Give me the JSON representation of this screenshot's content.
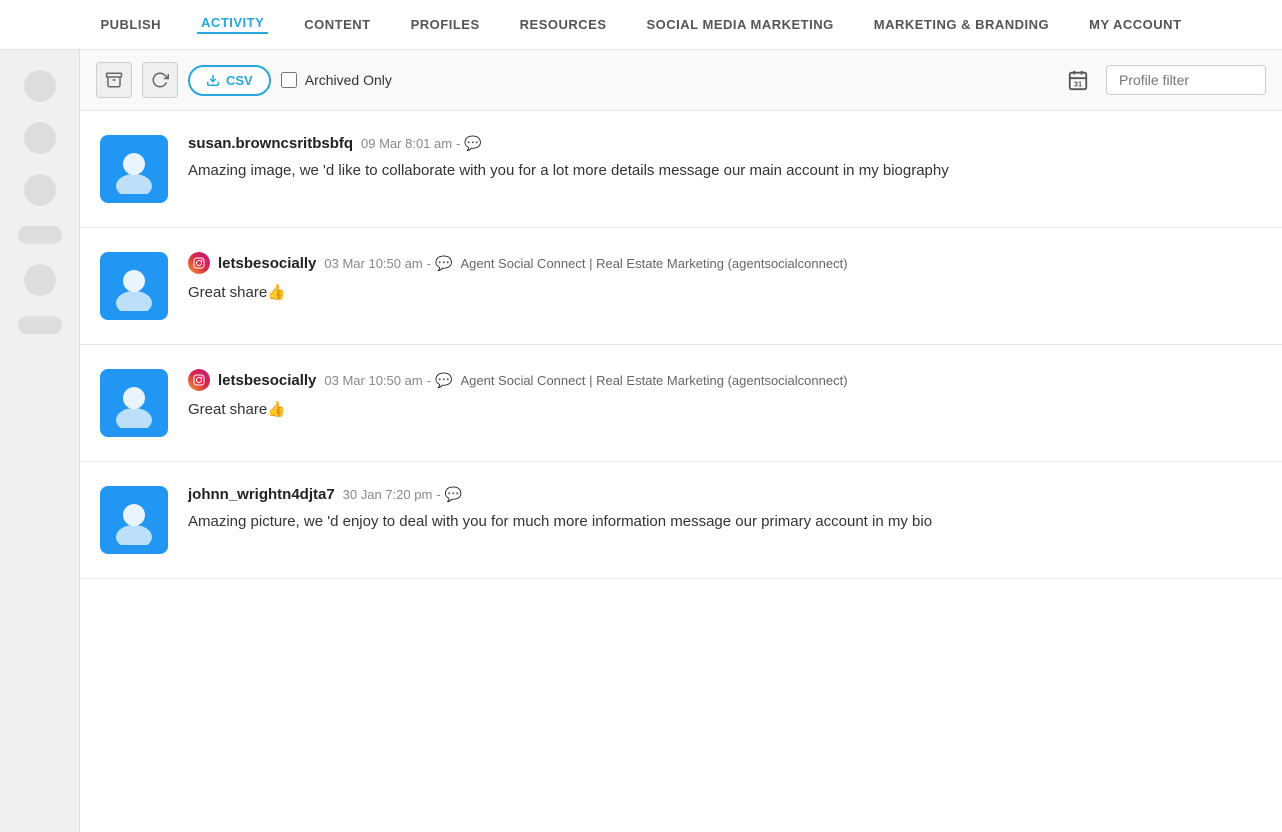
{
  "nav": {
    "items": [
      {
        "label": "PUBLISH",
        "active": false
      },
      {
        "label": "ACTIVITY",
        "active": true
      },
      {
        "label": "CONTENT",
        "active": false
      },
      {
        "label": "PROFILES",
        "active": false
      },
      {
        "label": "RESOURCES",
        "active": false
      },
      {
        "label": "SOCIAL MEDIA MARKETING",
        "active": false
      },
      {
        "label": "MARKETING & BRANDING",
        "active": false
      },
      {
        "label": "MY ACCOUNT",
        "active": false
      }
    ]
  },
  "toolbar": {
    "csv_label": "CSV",
    "archived_label": "Archived Only",
    "profile_filter_placeholder": "Profile filter"
  },
  "feed": {
    "items": [
      {
        "username": "susan.browncsritbsbfq",
        "date": "09 Mar 8:01 am",
        "has_comment": true,
        "platform": null,
        "source": null,
        "text": "Amazing image, we 'd like to collaborate with you for a lot more details message our main account in my biography"
      },
      {
        "username": "letsbesocially",
        "date": "03 Mar 10:50 am",
        "has_comment": true,
        "platform": "instagram",
        "source": "Agent Social Connect | Real Estate Marketing (agentsocialconnect)",
        "text": "Great share👍"
      },
      {
        "username": "letsbesocially",
        "date": "03 Mar 10:50 am",
        "has_comment": true,
        "platform": "instagram",
        "source": "Agent Social Connect | Real Estate Marketing (agentsocialconnect)",
        "text": "Great share👍"
      },
      {
        "username": "johnn_wrightn4djta7",
        "date": "30 Jan 7:20 pm",
        "has_comment": true,
        "platform": null,
        "source": null,
        "text": "Amazing picture, we 'd enjoy to deal with you for much more information message our primary account in my bio"
      }
    ]
  }
}
